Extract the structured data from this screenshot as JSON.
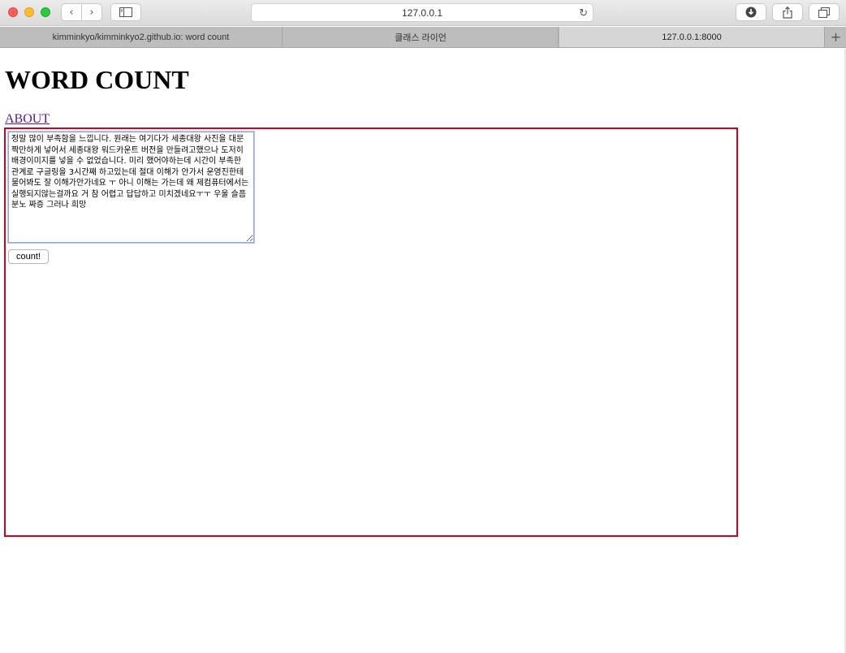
{
  "browser": {
    "url": "127.0.0.1",
    "tabs": [
      {
        "label": "kimminkyo/kimminkyo2.github.io: word count"
      },
      {
        "label": "클래스 라이언"
      },
      {
        "label": "127.0.0.1:8000"
      }
    ]
  },
  "page": {
    "title": "WORD COUNT",
    "about_link": "ABOUT",
    "textarea_value": "정말 많이 부족함을 느낍니다. 원래는 여기다가 세종대왕 사진을 대문짝만하게 넣어서 세종대왕 워드카운트 버전을 만들려고했으나 도저히 배경이미지를 넣을 수 없었습니다. 미리 했어야하는데 시간이 부족한 관계로 구글링을 3시간째 하고있는데 절대 이해가 안가서 운영진한테 물어봐도 잘 이해가안가네요 ㅜ 아니 이해는 가는데 왜 제컴퓨터에서는 실행되지않는걸까요 거 참 어렵고 답답하고 미치겠네요ㅜㅜ 우울 슬픔 분노 짜증 그러나 희망",
    "count_button": "count!"
  },
  "colors": {
    "form_border": "#d0021b",
    "link": "#551a8b"
  }
}
